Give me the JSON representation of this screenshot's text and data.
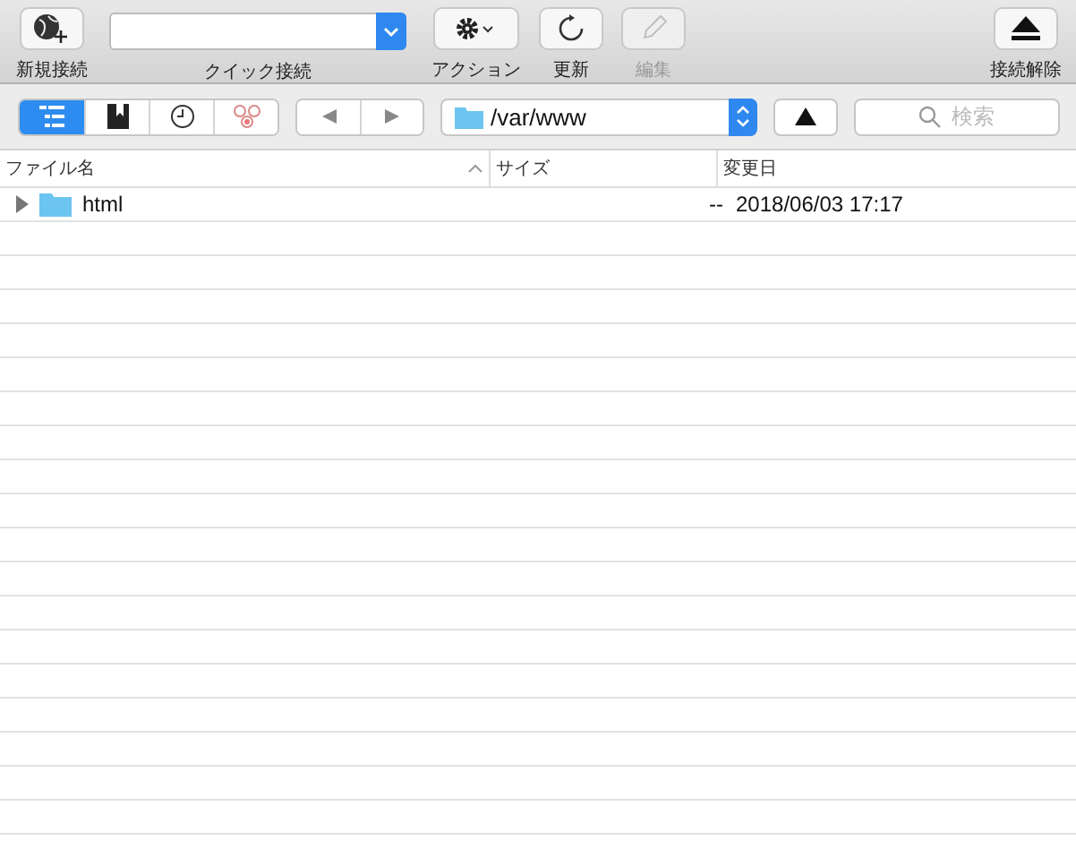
{
  "toolbar": [
    {
      "kind": "new",
      "label": "新規接続",
      "disabled": false
    },
    {
      "kind": "quick",
      "label": "クイック接続",
      "disabled": false
    },
    {
      "kind": "action",
      "label": "アクション",
      "disabled": false
    },
    {
      "kind": "refresh",
      "label": "更新",
      "disabled": false
    },
    {
      "kind": "edit",
      "label": "編集",
      "disabled": true
    },
    {
      "kind": "disconnect",
      "label": "接続解除",
      "disabled": false
    }
  ],
  "views": [
    {
      "kind": "browser",
      "selected": true
    },
    {
      "kind": "bookmarks",
      "selected": false
    },
    {
      "kind": "history",
      "selected": false
    },
    {
      "kind": "bonjour",
      "selected": false
    }
  ],
  "path": {
    "value": "/var/www"
  },
  "search": {
    "placeholder": "検索"
  },
  "table": {
    "columns": [
      "ファイル名",
      "サイズ",
      "変更日"
    ],
    "rows": [
      {
        "name": "html",
        "size": "--",
        "modified": "2018/06/03 17:17",
        "expanded": false
      }
    ]
  }
}
